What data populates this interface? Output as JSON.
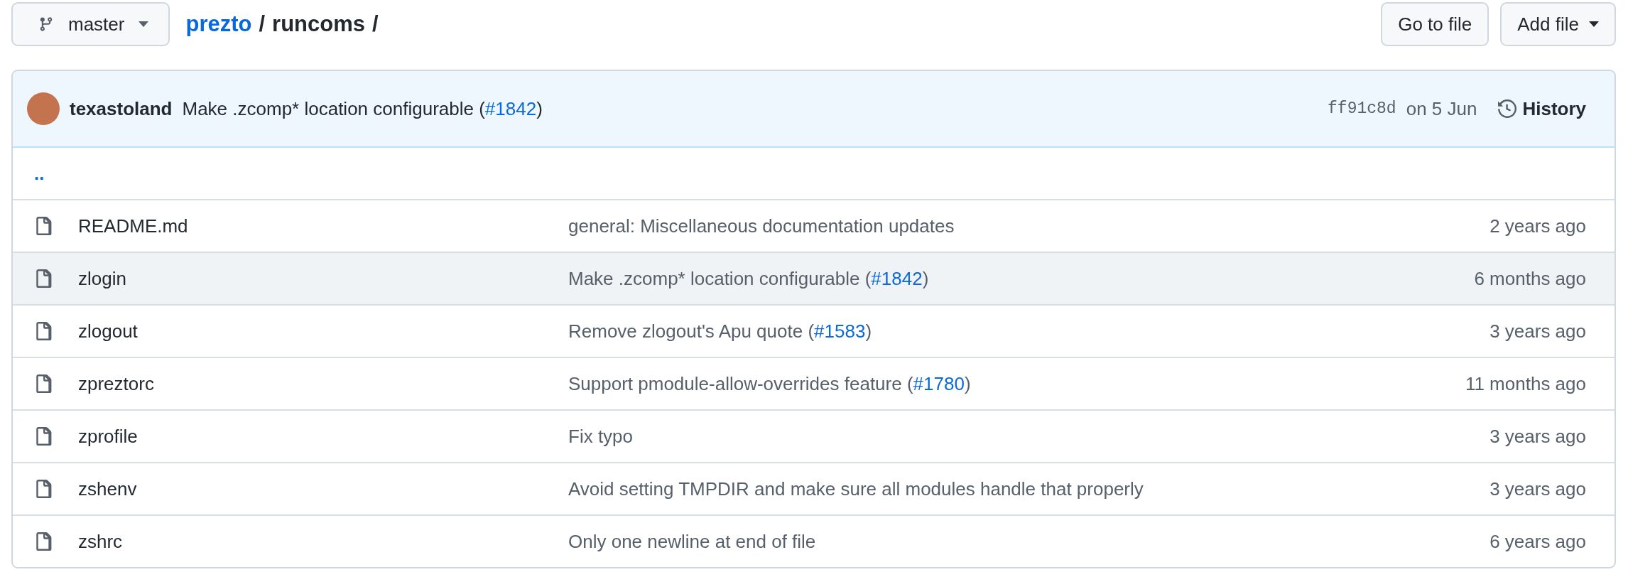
{
  "branch": {
    "name": "master"
  },
  "breadcrumb": {
    "repo": "prezto",
    "path": [
      {
        "text": "/"
      },
      {
        "text": "runcoms"
      },
      {
        "text": "/"
      }
    ]
  },
  "actions": [
    "Go to file",
    "Add file"
  ],
  "latest_commit": {
    "author": "texastoland",
    "message": [
      {
        "kind": "text",
        "text": "Make .zcomp* location configurable ("
      },
      {
        "kind": "link",
        "text": "#1842"
      },
      {
        "kind": "text",
        "text": ")"
      }
    ],
    "sha": "ff91c8d",
    "date": "on 5 Jun",
    "history": "History"
  },
  "parent_link": "..",
  "files": [
    {
      "name": "README.md",
      "selected": false,
      "message": [
        {
          "kind": "text",
          "text": "general: Miscellaneous documentation updates"
        }
      ],
      "age": "2 years ago"
    },
    {
      "name": "zlogin",
      "selected": true,
      "message": [
        {
          "kind": "text",
          "text": "Make .zcomp* location configurable ("
        },
        {
          "kind": "link",
          "text": "#1842"
        },
        {
          "kind": "text",
          "text": ")"
        }
      ],
      "age": "6 months ago"
    },
    {
      "name": "zlogout",
      "selected": false,
      "message": [
        {
          "kind": "text",
          "text": "Remove zlogout's Apu quote ("
        },
        {
          "kind": "link",
          "text": "#1583"
        },
        {
          "kind": "text",
          "text": ")"
        }
      ],
      "age": "3 years ago"
    },
    {
      "name": "zpreztorc",
      "selected": false,
      "message": [
        {
          "kind": "text",
          "text": "Support pmodule-allow-overrides feature ("
        },
        {
          "kind": "link",
          "text": "#1780"
        },
        {
          "kind": "text",
          "text": ")"
        }
      ],
      "age": "11 months ago"
    },
    {
      "name": "zprofile",
      "selected": false,
      "message": [
        {
          "kind": "text",
          "text": "Fix typo"
        }
      ],
      "age": "3 years ago"
    },
    {
      "name": "zshenv",
      "selected": false,
      "message": [
        {
          "kind": "text",
          "text": "Avoid setting TMPDIR and make sure all modules handle that properly"
        }
      ],
      "age": "3 years ago"
    },
    {
      "name": "zshrc",
      "selected": false,
      "message": [
        {
          "kind": "text",
          "text": "Only one newline at end of file"
        }
      ],
      "age": "6 years ago"
    }
  ]
}
